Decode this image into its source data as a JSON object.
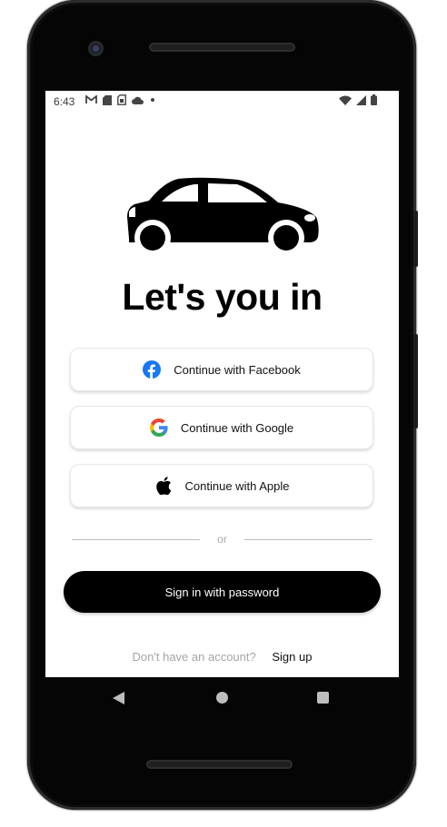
{
  "status_bar": {
    "time": "6:43",
    "left_icons": [
      "gmail-icon",
      "sd-card-icon",
      "sim-icon",
      "cloud-icon",
      "dot-icon"
    ],
    "right_icons": [
      "wifi-icon",
      "signal-icon",
      "battery-icon"
    ]
  },
  "hero": {
    "icon": "car-icon"
  },
  "title": "Let's you in",
  "social_buttons": [
    {
      "label": "Continue with Facebook",
      "icon": "facebook-icon",
      "color": "#1877F2"
    },
    {
      "label": "Continue with Google",
      "icon": "google-icon"
    },
    {
      "label": "Continue with Apple",
      "icon": "apple-icon",
      "color": "#000000"
    }
  ],
  "divider": {
    "text": "or"
  },
  "primary_button": {
    "label": "Sign in with password",
    "color": "#000000"
  },
  "footer": {
    "prompt": "Don't have an account?",
    "link": "Sign up"
  },
  "navigation": {
    "icons": [
      "back-icon",
      "home-icon",
      "recents-icon"
    ]
  }
}
